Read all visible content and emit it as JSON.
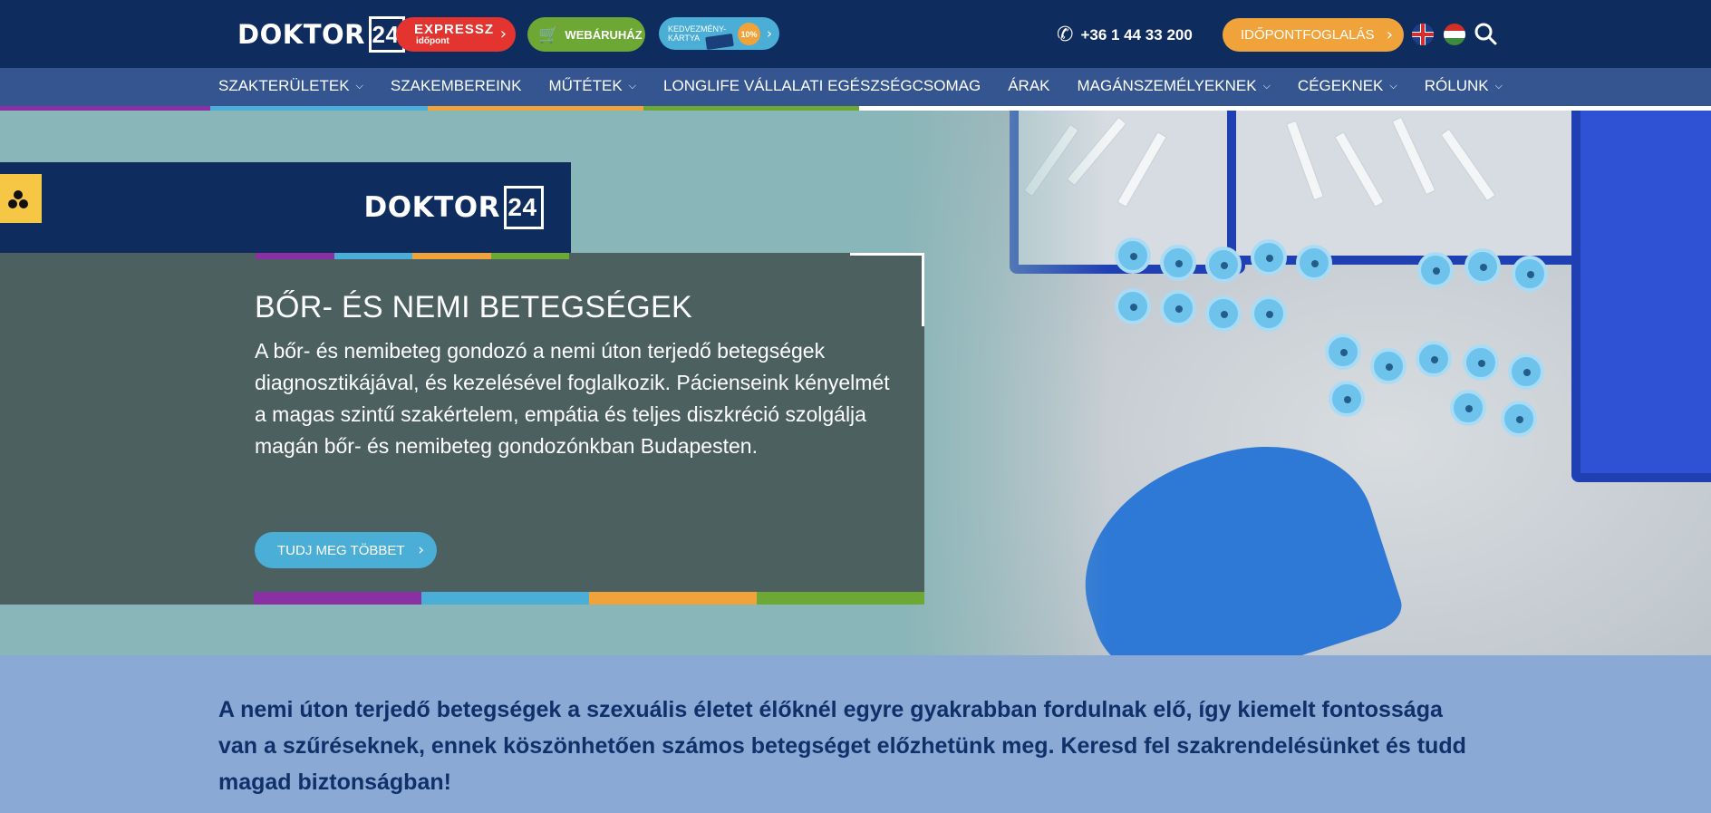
{
  "header": {
    "logo_word": "DOKTOR",
    "logo_num": "24",
    "expressz_line1": "EXPRESSZ",
    "expressz_line2": "időpont",
    "webaruhaz": "WEBÁRUHÁZ",
    "kartya_text": "KEDVEZMÉNY-KÁRTYA",
    "kartya_badge": "10%",
    "phone": "+36 1 44 33 200",
    "booking": "IDŐPONTFOGLALÁS"
  },
  "nav": {
    "items": [
      {
        "label": "SZAKTERÜLETEK",
        "dropdown": true
      },
      {
        "label": "SZAKEMBEREINK",
        "dropdown": false
      },
      {
        "label": "MŰTÉTEK",
        "dropdown": true
      },
      {
        "label": "LONGLIFE VÁLLALATI EGÉSZSÉGCSOMAG",
        "dropdown": false
      },
      {
        "label": "ÁRAK",
        "dropdown": false
      },
      {
        "label": "MAGÁNSZEMÉLYEKNEK",
        "dropdown": true
      },
      {
        "label": "CÉGEKNEK",
        "dropdown": true
      },
      {
        "label": "RÓLUNK",
        "dropdown": true
      }
    ]
  },
  "hero": {
    "logo_word": "DOKTOR",
    "logo_num": "24",
    "title": "BŐR- ÉS NEMI BETEGSÉGEK",
    "description": "A bőr- és nemibeteg gondozó a nemi úton terjedő betegségek diagnosztikájával, és kezelésével foglalkozik. Pácienseink kényelmét a magas szintű szakértelem, empátia és teljes diszkréció szolgálja magán bőr- és nemibeteg gondozónkban Budapesten.",
    "button": "TUDJ MEG TÖBBET"
  },
  "intro": {
    "text": "A nemi úton terjedő betegségek a szexuális életet élőknél egyre gyakrabban fordulnak elő, így kiemelt fontossága van a szűréseknek, ennek köszönhetően számos betegséget előzhetünk meg. Keresd fel szakrendelésünket és tudd magad biztonságban!"
  },
  "colors": {
    "navy": "#0f2c5f",
    "nav_bg": "#34558f",
    "purple": "#8b2fa5",
    "light_blue": "#4aaed6",
    "orange": "#f0a23b",
    "green": "#6ca833",
    "red": "#e3342f"
  },
  "icons": [
    "phone-icon",
    "cart-icon",
    "search-icon",
    "chevron-right-icon",
    "chevron-down-icon",
    "accessibility-icon",
    "flag-uk-icon",
    "flag-hu-icon"
  ]
}
